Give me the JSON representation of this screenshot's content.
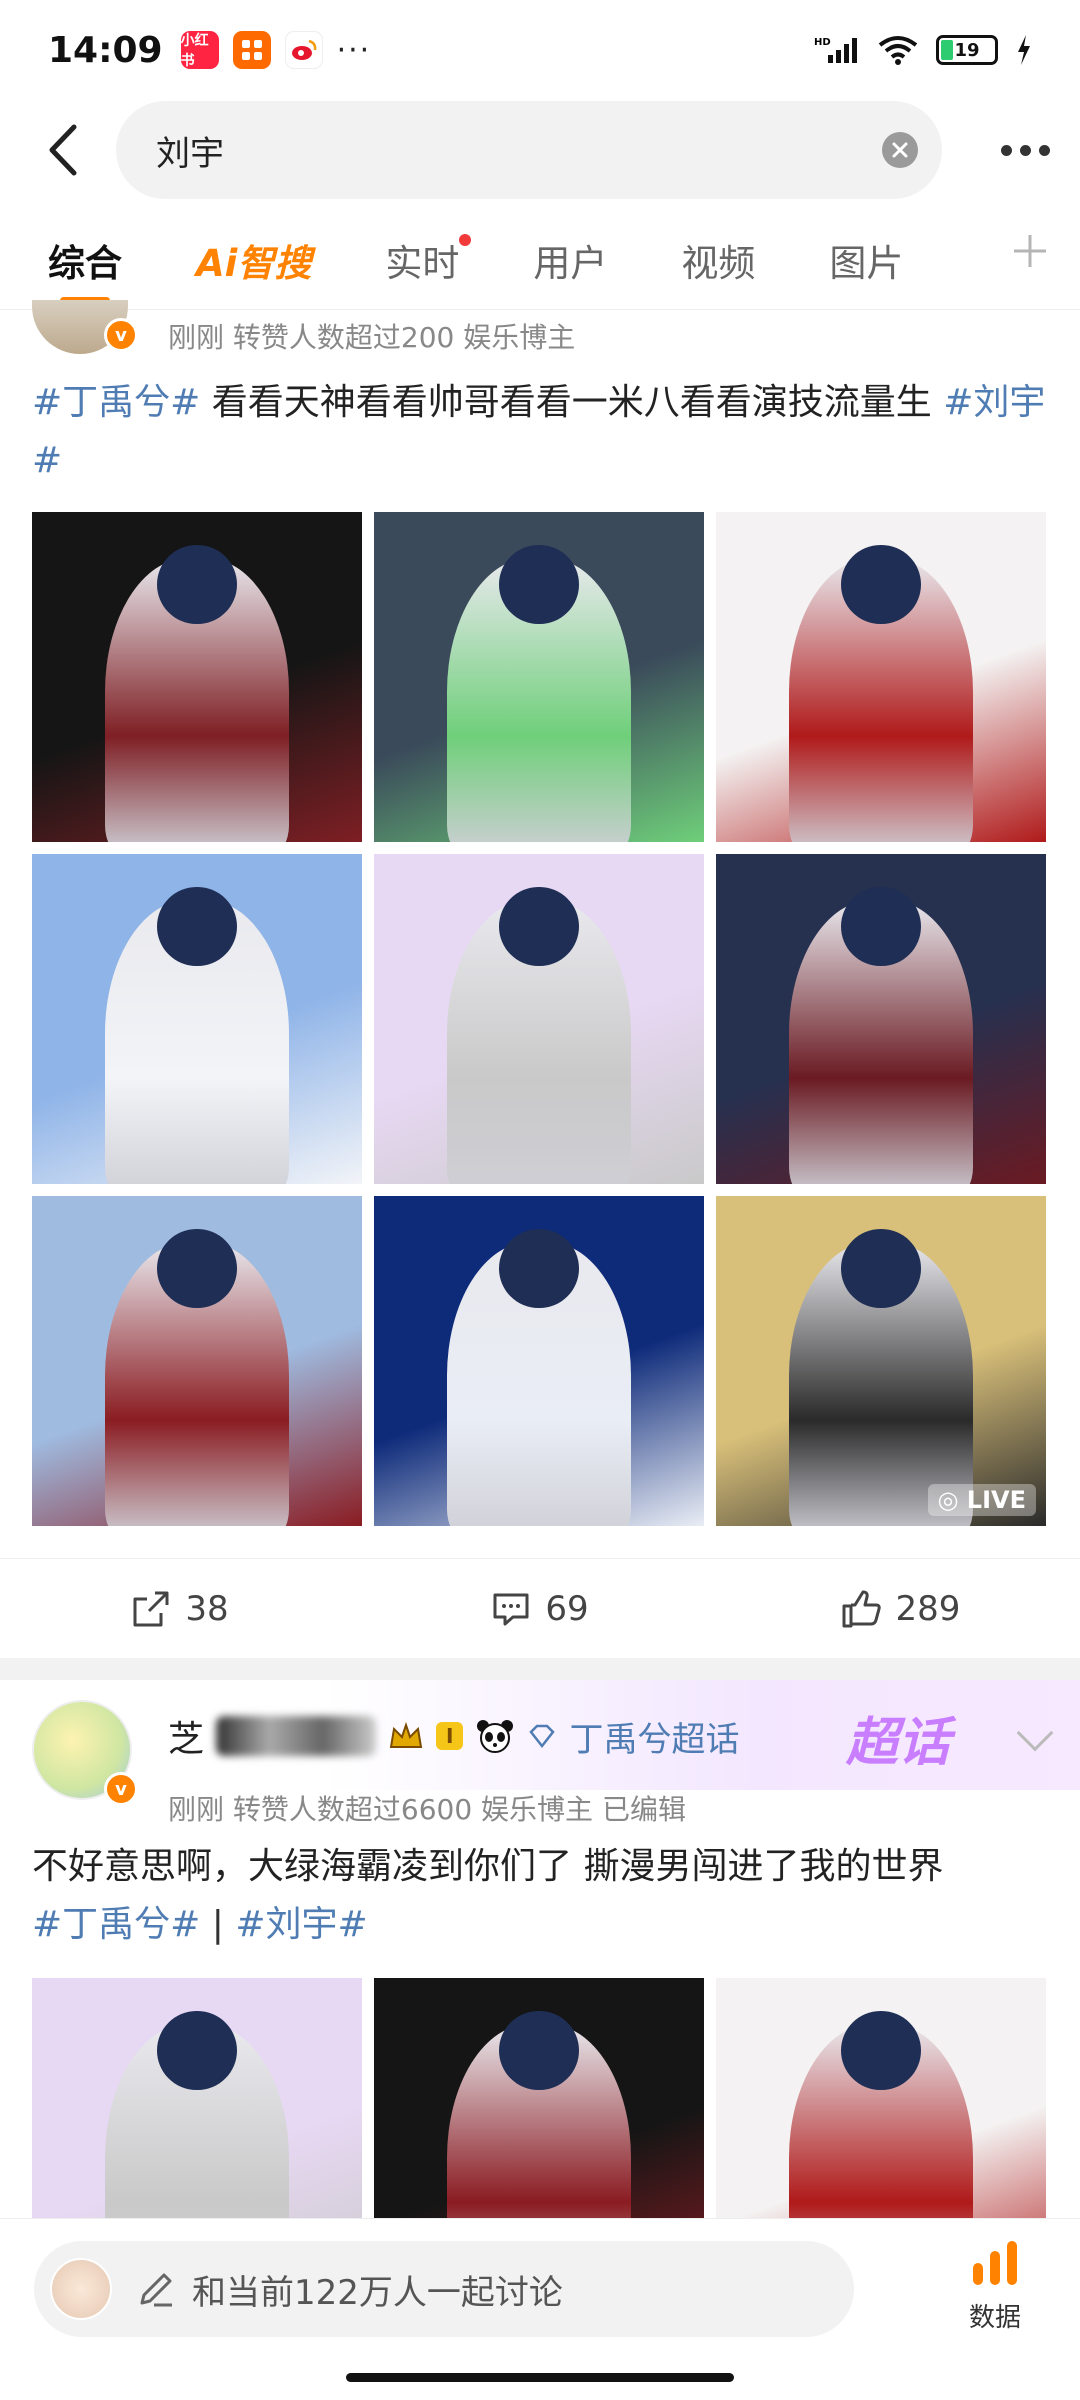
{
  "status_bar": {
    "time": "14:09",
    "battery": "19",
    "app_icons": [
      {
        "name": "xiaohongshu-app-icon",
        "label": "小红书",
        "color": "#ff2442"
      },
      {
        "name": "orange-app-icon",
        "label": "",
        "color": "#ff6a00"
      },
      {
        "name": "weibo-app-icon",
        "label": "",
        "color": "#e6162d"
      }
    ],
    "overflow": "···"
  },
  "search": {
    "query": "刘宇"
  },
  "tabs": [
    {
      "label": "综合",
      "active": true
    },
    {
      "label": "Ai智搜",
      "active": false
    },
    {
      "label": "实时",
      "active": false,
      "dot": true
    },
    {
      "label": "用户",
      "active": false
    },
    {
      "label": "视频",
      "active": false
    },
    {
      "label": "图片",
      "active": false
    }
  ],
  "post1": {
    "meta": "刚刚  转赞人数超过200   娱乐博主",
    "text_parts": [
      "#丁禹兮#",
      " 看看天神看看帅哥看看一米八看看演技流量生 ",
      "#刘宇#"
    ],
    "photo_colors": [
      [
        "#151515",
        "#7e1f24"
      ],
      [
        "#3a4a5a",
        "#6fcf7a"
      ],
      [
        "#f4f2f2",
        "#b01a1a"
      ],
      [
        "#8fb4e8",
        "#f2f4f8"
      ],
      [
        "#e7d8f3",
        "#c9c9c9"
      ],
      [
        "#26304f",
        "#6a1a22"
      ],
      [
        "#9fbbe0",
        "#8a1c22"
      ],
      [
        "#0e2b7a",
        "#e9edf5"
      ],
      [
        "#d9c07a",
        "#2a2a2a"
      ]
    ],
    "live_label": "◎ LIVE",
    "repost_count": "38",
    "comment_count": "69",
    "like_count": "289"
  },
  "post2": {
    "name_fragment": "芝",
    "level": "I",
    "topic": "丁禹兮超话",
    "chaohua_label": "超话",
    "meta": "刚刚  转赞人数超过6600   娱乐博主   已编辑",
    "text_line1": "不好意思啊，大绿海霸凌到你们了 撕漫男闯进了我的世界",
    "tags": [
      "#丁禹兮#",
      "#刘宇#"
    ],
    "tag_separator": " | ",
    "photo_colors": [
      [
        "#e7d8f3",
        "#c9c9c9"
      ],
      [
        "#151515",
        "#8a1c22"
      ],
      [
        "#f4f2f2",
        "#b01a1a"
      ]
    ]
  },
  "bottom": {
    "discuss_text": "和当前122万人一起讨论",
    "data_label": "数据"
  },
  "colors": {
    "accent": "#ff8200",
    "link": "#4f7cb3"
  }
}
